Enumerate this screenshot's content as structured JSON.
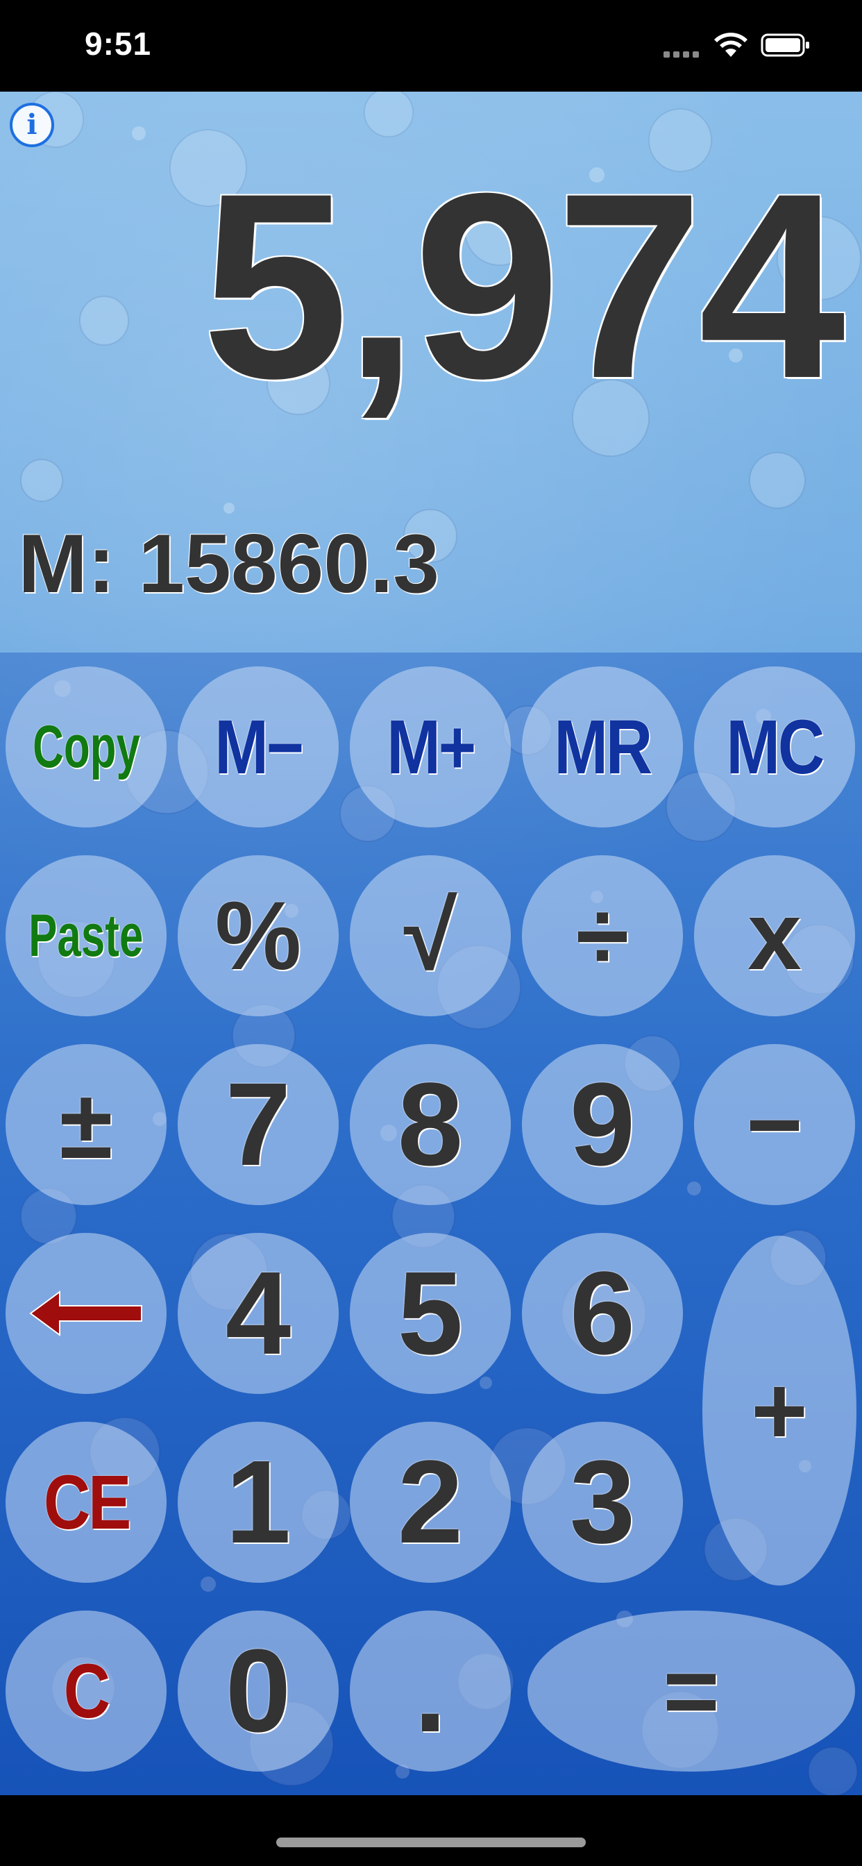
{
  "status_bar": {
    "time": "9:51"
  },
  "display": {
    "value": "5,974",
    "memory": "M: 15860.3"
  },
  "info_button": {
    "label": "i",
    "icon": "info-icon"
  },
  "keypad": {
    "row1": [
      "Copy",
      "M−",
      "M+",
      "MR",
      "MC"
    ],
    "row2": [
      "Paste",
      "%",
      "√",
      "÷",
      "x"
    ],
    "row3": [
      "±",
      "7",
      "8",
      "9",
      "−"
    ],
    "row4": [
      "back-arrow",
      "4",
      "5",
      "6"
    ],
    "row5": [
      "CE",
      "1",
      "2",
      "3"
    ],
    "row6": [
      "C",
      "0",
      ".",
      "="
    ],
    "plus": "+"
  },
  "colors": {
    "function_green": "#117a11",
    "memory_blue": "#1133a0",
    "clear_red": "#a00d0d",
    "digit_dark": "#333333"
  }
}
